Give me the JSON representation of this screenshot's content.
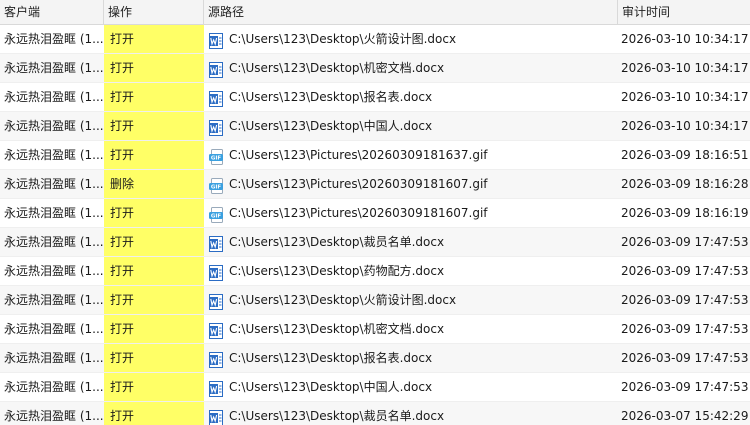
{
  "columns": {
    "client": "客户端",
    "operation": "操作",
    "source_path": "源路径",
    "audit_time": "审计时间"
  },
  "colors": {
    "operation_column_bg": "#ffff66",
    "word_icon": "#2b6cc4",
    "gif_icon": "#3aa0e0"
  },
  "rows": [
    {
      "client": "永远热泪盈眶 (1...",
      "operation": "打开",
      "icon": "word-doc-icon",
      "path": "C:\\Users\\123\\Desktop\\火箭设计图.docx",
      "time": "2026-03-10 10:34:17"
    },
    {
      "client": "永远热泪盈眶 (1...",
      "operation": "打开",
      "icon": "word-doc-icon",
      "path": "C:\\Users\\123\\Desktop\\机密文档.docx",
      "time": "2026-03-10 10:34:17"
    },
    {
      "client": "永远热泪盈眶 (1...",
      "operation": "打开",
      "icon": "word-doc-icon",
      "path": "C:\\Users\\123\\Desktop\\报名表.docx",
      "time": "2026-03-10 10:34:17"
    },
    {
      "client": "永远热泪盈眶 (1...",
      "operation": "打开",
      "icon": "word-doc-icon",
      "path": "C:\\Users\\123\\Desktop\\中国人.docx",
      "time": "2026-03-10 10:34:17"
    },
    {
      "client": "永远热泪盈眶 (1...",
      "operation": "打开",
      "icon": "gif-image-icon",
      "path": "C:\\Users\\123\\Pictures\\20260309181637.gif",
      "time": "2026-03-09 18:16:51"
    },
    {
      "client": "永远热泪盈眶 (1...",
      "operation": "删除",
      "icon": "gif-image-icon",
      "path": "C:\\Users\\123\\Pictures\\20260309181607.gif",
      "time": "2026-03-09 18:16:28"
    },
    {
      "client": "永远热泪盈眶 (1...",
      "operation": "打开",
      "icon": "gif-image-icon",
      "path": "C:\\Users\\123\\Pictures\\20260309181607.gif",
      "time": "2026-03-09 18:16:19"
    },
    {
      "client": "永远热泪盈眶 (1...",
      "operation": "打开",
      "icon": "word-doc-icon",
      "path": "C:\\Users\\123\\Desktop\\裁员名单.docx",
      "time": "2026-03-09 17:47:53"
    },
    {
      "client": "永远热泪盈眶 (1...",
      "operation": "打开",
      "icon": "word-doc-icon",
      "path": "C:\\Users\\123\\Desktop\\药物配方.docx",
      "time": "2026-03-09 17:47:53"
    },
    {
      "client": "永远热泪盈眶 (1...",
      "operation": "打开",
      "icon": "word-doc-icon",
      "path": "C:\\Users\\123\\Desktop\\火箭设计图.docx",
      "time": "2026-03-09 17:47:53"
    },
    {
      "client": "永远热泪盈眶 (1...",
      "operation": "打开",
      "icon": "word-doc-icon",
      "path": "C:\\Users\\123\\Desktop\\机密文档.docx",
      "time": "2026-03-09 17:47:53"
    },
    {
      "client": "永远热泪盈眶 (1...",
      "operation": "打开",
      "icon": "word-doc-icon",
      "path": "C:\\Users\\123\\Desktop\\报名表.docx",
      "time": "2026-03-09 17:47:53"
    },
    {
      "client": "永远热泪盈眶 (1...",
      "operation": "打开",
      "icon": "word-doc-icon",
      "path": "C:\\Users\\123\\Desktop\\中国人.docx",
      "time": "2026-03-09 17:47:53"
    },
    {
      "client": "永远热泪盈眶 (1...",
      "operation": "打开",
      "icon": "word-doc-icon",
      "path": "C:\\Users\\123\\Desktop\\裁员名单.docx",
      "time": "2026-03-07 15:42:29"
    }
  ]
}
